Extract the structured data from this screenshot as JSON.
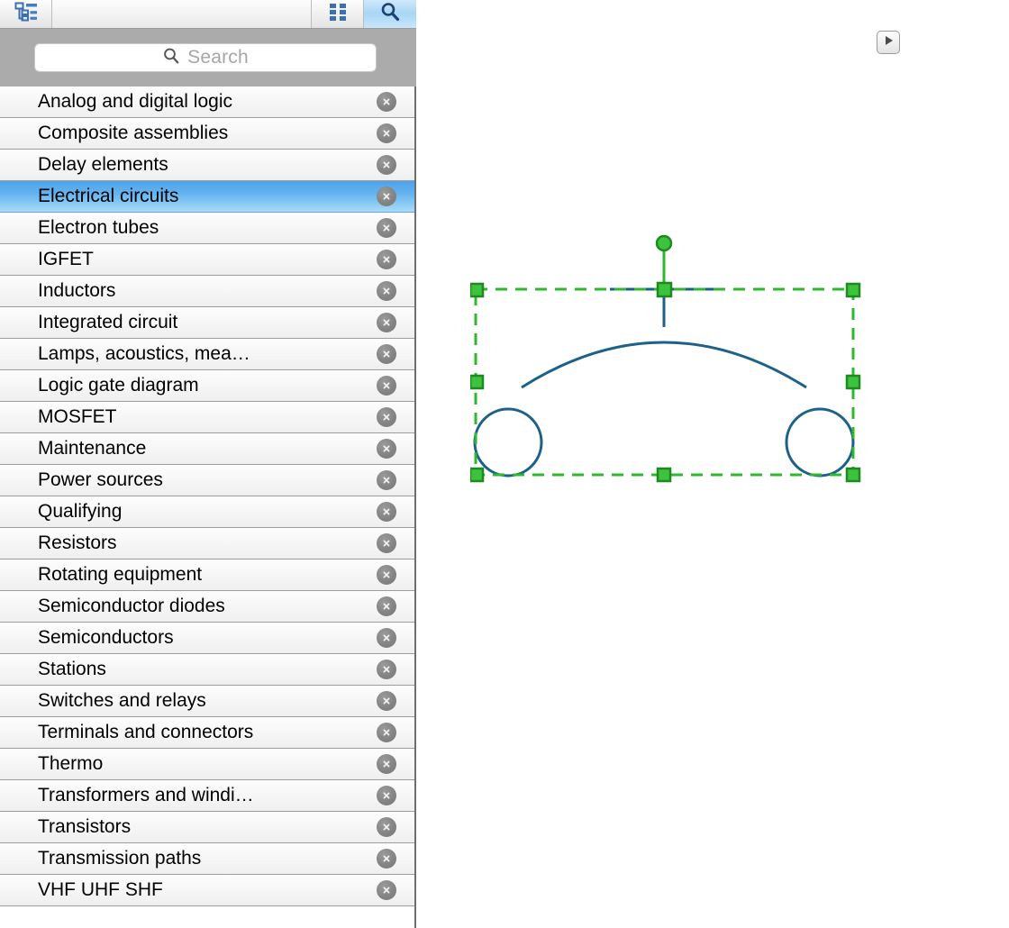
{
  "panel": {
    "toolbar": {
      "hierarchy_icon": "hierarchy-outline-icon",
      "grid_icon": "grid-view-icon",
      "search_icon": "search-icon",
      "active_tool": "search"
    },
    "search": {
      "placeholder": "Search",
      "value": "",
      "icon": "search-icon"
    },
    "list": {
      "selected_index": 3,
      "delete_icon": "remove-circle-icon",
      "items": [
        {
          "label": "Analog and digital logic"
        },
        {
          "label": "Composite assemblies"
        },
        {
          "label": "Delay elements"
        },
        {
          "label": "Electrical circuits"
        },
        {
          "label": "Electron tubes"
        },
        {
          "label": "IGFET"
        },
        {
          "label": "Inductors"
        },
        {
          "label": "Integrated circuit"
        },
        {
          "label": "Lamps, acoustics, mea…"
        },
        {
          "label": "Logic gate diagram"
        },
        {
          "label": "MOSFET"
        },
        {
          "label": "Maintenance"
        },
        {
          "label": "Power sources"
        },
        {
          "label": "Qualifying"
        },
        {
          "label": "Resistors"
        },
        {
          "label": "Rotating equipment"
        },
        {
          "label": "Semiconductor diodes"
        },
        {
          "label": "Semiconductors"
        },
        {
          "label": "Stations"
        },
        {
          "label": "Switches and relays"
        },
        {
          "label": "Terminals and connectors"
        },
        {
          "label": "Thermo"
        },
        {
          "label": "Transformers and windi…"
        },
        {
          "label": "Transistors"
        },
        {
          "label": "Transmission paths"
        },
        {
          "label": "VHF UHF SHF"
        }
      ]
    }
  },
  "canvas": {
    "shape": {
      "name": "electrical-symbol-shape",
      "stroke_color": "#1c6189",
      "selection_color": "#2eb82e",
      "handle_fill": "#3cc23c",
      "handle_border": "#1f8a1f"
    },
    "expand_button": {
      "icon": "play-triangle-icon"
    }
  },
  "colors": {
    "panel_background": "#ababab",
    "row_separator": "#9d9d9d",
    "selection_blue_top": "#4ea2e8",
    "selection_blue_bottom": "#a9dcf7",
    "toolbar_active_blue": "#a8d6f4",
    "icon_blue": "#3a6fb0"
  }
}
